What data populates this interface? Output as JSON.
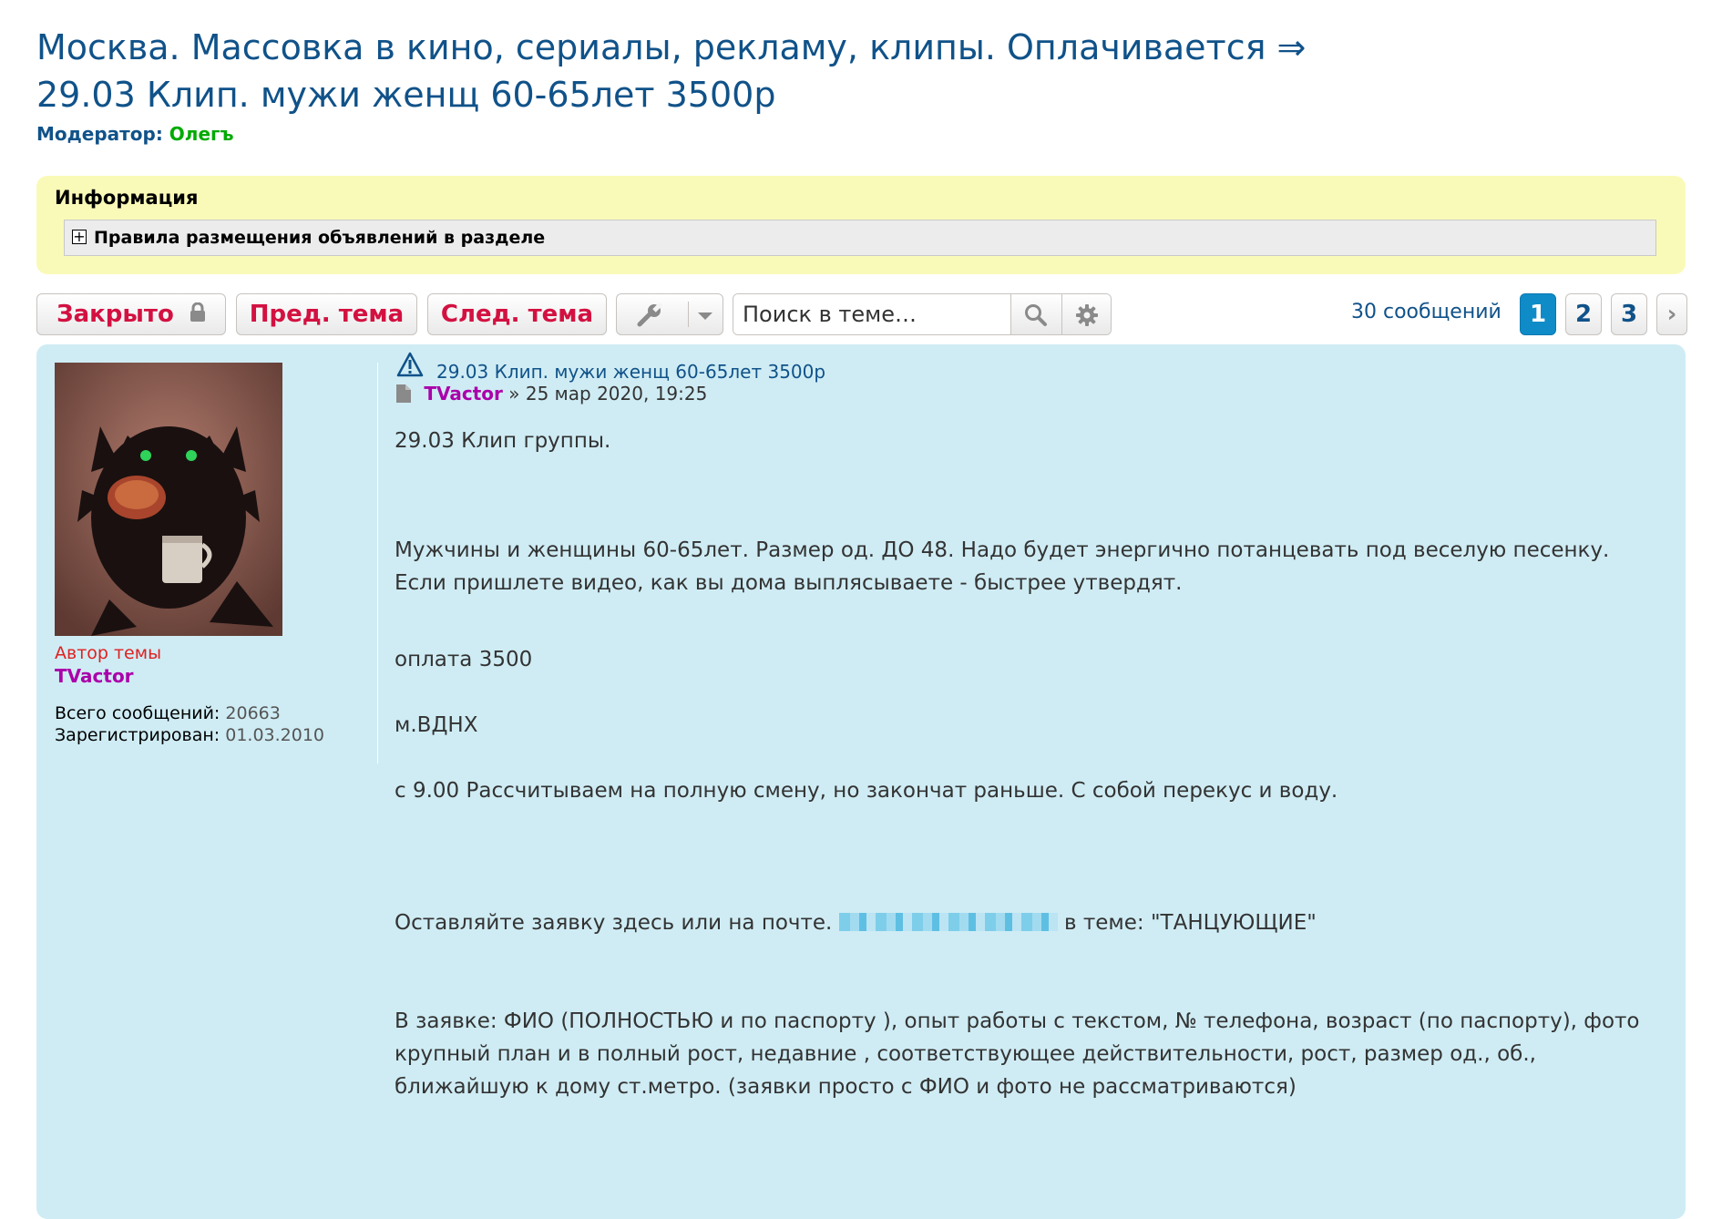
{
  "topic": {
    "line1": "Москва. Массовка в кино, сериалы, рекламу, клипы. Оплачивается ⇒",
    "line2": "29.03 Клип. мужи женщ 60-65лет 3500р",
    "moderator_label": "Модератор:",
    "moderator_name": "Олегъ"
  },
  "info": {
    "title": "Информация",
    "rules_label": "Правила размещения объявлений в разделе",
    "expand_symbol": "+"
  },
  "toolbar": {
    "closed_label": "Закрыто",
    "prev_label": "Пред. тема",
    "next_label": "След. тема",
    "search_placeholder": "Поиск в теме…",
    "post_count": "30 сообщений",
    "pages": [
      "1",
      "2",
      "3"
    ],
    "active_page": "1",
    "next_page_symbol": "›"
  },
  "author": {
    "role": "Автор темы",
    "name": "TVactor",
    "posts_label": "Всего сообщений:",
    "posts_value": "20663",
    "registered_label": "Зарегистрирован:",
    "registered_value": "01.03.2010"
  },
  "post": {
    "title": "29.03 Клип. мужи женщ 60-65лет 3500р",
    "author": "TVactor",
    "date_sep": "»",
    "date": "25 мар 2020, 19:25",
    "p1": "29.03 Клип группы.",
    "p2": "Мужчины и женщины 60-65лет. Размер од. ДО 48. Надо будет энергично потанцевать под веселую песенку. Если пришлете видео, как вы дома выплясываете - быстрее утвердят.",
    "p3": "оплата 3500",
    "p4": "м.ВДНХ",
    "p5": "с 9.00 Рассчитываем на полную смену, но закончат раньше. С собой перекус и воду.",
    "p6_before": "Оставляйте заявку здесь или на почте.",
    "p6_after": "в теме: \"ТАНЦУЮЩИЕ\"",
    "p7": "В заявке: ФИО (ПОЛНОСТЬЮ и по паспорту ), опыт работы с текстом, № телефона, возраст (по паспорту), фото крупный план и в полный рост, недавние , соответствующее действительности, рост, размер од., об., ближайшую к дому ст.метро. (заявки просто с ФИО и фото не рассматриваются)"
  },
  "colors": {
    "link": "#105289",
    "button_text": "#d31141",
    "moderator": "#00aa00",
    "author": "#aa00aa",
    "author_role": "#e02020",
    "post_bg": "#cfecf4",
    "info_bg": "#fafab8",
    "page_active": "#0f8cc8"
  }
}
